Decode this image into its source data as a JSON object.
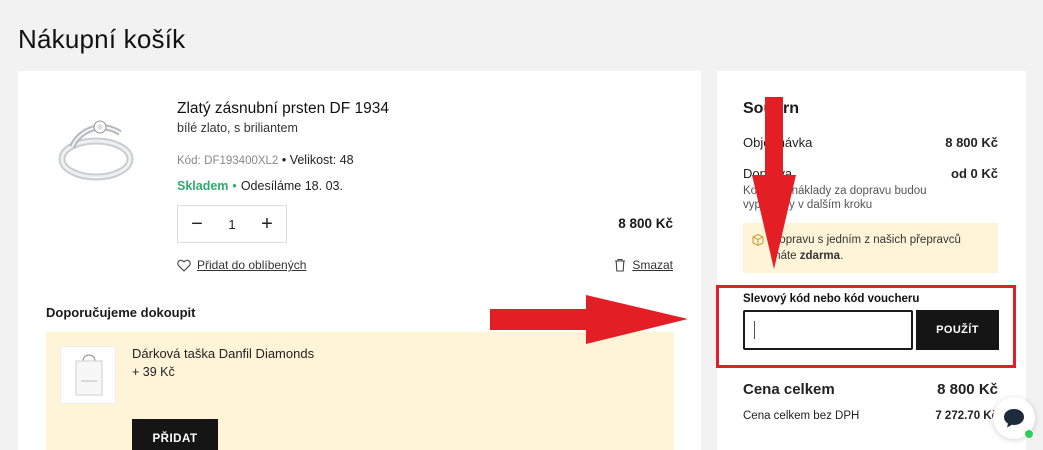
{
  "page": {
    "title": "Nákupní košík"
  },
  "cart": {
    "item": {
      "name": "Zlatý zásnubní prsten DF 1934",
      "variant": "bílé zlato, s briliantem",
      "code_label": "Kód:",
      "code": "DF193400XL2",
      "size_label": "Velikost:",
      "size": "48",
      "stock": "Skladem",
      "shipping": "Odesíláme 18. 03.",
      "quantity": "1",
      "price": "8 800 Kč",
      "wishlist_label": "Přidat do oblíbených",
      "delete_label": "Smazat",
      "image_icon": "ring-image"
    },
    "recommend": {
      "title": "Doporučujeme dokoupit",
      "product_name": "Dárková taška Danfil Diamonds",
      "product_price": "+ 39 Kč",
      "add_label": "PŘIDAT"
    }
  },
  "summary": {
    "title": "Souhrn",
    "order_label": "Objednávka",
    "order_value": "8 800 Kč",
    "shipping_label": "Doprava",
    "shipping_value": "od 0 Kč",
    "shipping_note": "Konečné náklady za dopravu budou vypočteny v dalším kroku",
    "free_shipping_text": "Dopravu s jedním z našich přepravců máte",
    "free_shipping_bold": "zdarma",
    "free_shipping_end": ".",
    "voucher_label": "Slevový kód nebo kód voucheru",
    "voucher_value": "",
    "voucher_placeholder": "",
    "apply_label": "POUŽÍT",
    "total_label": "Cena celkem",
    "total_value": "8 800 Kč",
    "net_label": "Cena celkem bez DPH",
    "net_value": "7 272.70 Kč"
  },
  "colors": {
    "accent_green": "#2eac6d",
    "annotation_red": "#e31e24",
    "highlight_bg": "#fff4d8",
    "button_dark": "#151515"
  }
}
